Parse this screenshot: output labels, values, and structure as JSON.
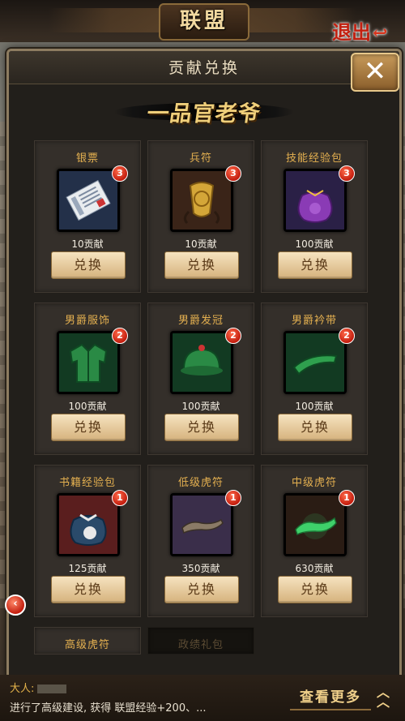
{
  "top": {
    "title": "联盟",
    "exit_label": "退出"
  },
  "modal": {
    "title": "贡献兑换",
    "close_label": "✕",
    "rank": "一品官老爷",
    "items": [
      {
        "name": "银票",
        "badge": "3",
        "cost": "10贡献",
        "button": "兑换",
        "frame": "gray",
        "icon": "banknote-icon"
      },
      {
        "name": "兵符",
        "badge": "3",
        "cost": "10贡献",
        "button": "兑换",
        "frame": "gray",
        "icon": "military-tally-icon"
      },
      {
        "name": "技能经验包",
        "badge": "3",
        "cost": "100贡献",
        "button": "兑换",
        "frame": "blue",
        "icon": "skill-xp-pouch-icon"
      },
      {
        "name": "男爵服饰",
        "badge": "2",
        "cost": "100贡献",
        "button": "兑换",
        "frame": "green",
        "icon": "robe-icon"
      },
      {
        "name": "男爵发冠",
        "badge": "2",
        "cost": "100贡献",
        "button": "兑换",
        "frame": "green",
        "icon": "cap-icon"
      },
      {
        "name": "男爵衿带",
        "badge": "2",
        "cost": "100贡献",
        "button": "兑换",
        "frame": "green",
        "icon": "belt-icon"
      },
      {
        "name": "书籍经验包",
        "badge": "1",
        "cost": "125贡献",
        "button": "兑换",
        "frame": "blue",
        "icon": "book-xp-pouch-icon"
      },
      {
        "name": "低级虎符",
        "badge": "1",
        "cost": "350贡献",
        "button": "兑换",
        "frame": "purple",
        "icon": "bronze-tiger-tally-icon"
      },
      {
        "name": "中级虎符",
        "badge": "1",
        "cost": "630贡献",
        "button": "兑换",
        "frame": "red",
        "icon": "jade-tiger-tally-icon"
      }
    ],
    "partial_items": [
      {
        "name": "高级虎符",
        "locked": false
      },
      {
        "name": "政绩礼包",
        "locked": true
      }
    ]
  },
  "chat": {
    "speaker": "大人:",
    "message": "进行了高级建设, 获得 联盟经验+200、...",
    "more_label": "查看更多",
    "expand_icon": "double-chevron-up-icon"
  },
  "side": {
    "arrow_icon": "chevron-left-icon"
  }
}
